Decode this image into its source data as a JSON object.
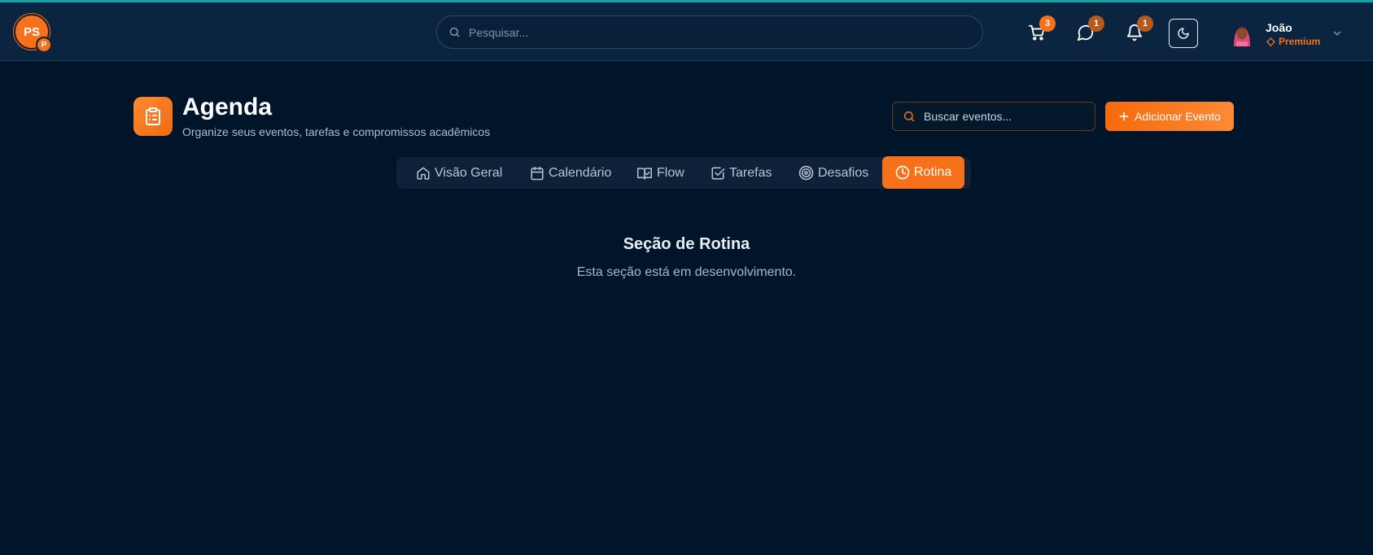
{
  "header": {
    "logo_text": "PS",
    "logo_badge": "P",
    "search_placeholder": "Pesquisar...",
    "cart_count": "3",
    "messages_count": "1",
    "notifications_count": "1",
    "user": {
      "name": "João",
      "plan": "Premium"
    }
  },
  "page": {
    "title": "Agenda",
    "subtitle": "Organize seus eventos, tarefas e compromissos acadêmicos",
    "search_placeholder": "Buscar eventos...",
    "add_button": "Adicionar Evento"
  },
  "tabs": [
    {
      "label": "Visão Geral",
      "icon": "home-icon"
    },
    {
      "label": "Calendário",
      "icon": "calendar-icon"
    },
    {
      "label": "Flow",
      "icon": "book-check-icon"
    },
    {
      "label": "Tarefas",
      "icon": "checkbox-icon"
    },
    {
      "label": "Desafios",
      "icon": "target-icon"
    },
    {
      "label": "Rotina",
      "icon": "clock-icon",
      "active": true
    }
  ],
  "content": {
    "title": "Seção de Rotina",
    "description": "Esta seção está em desenvolvimento."
  },
  "colors": {
    "accent": "#f7711a",
    "background": "#00152a",
    "header": "#0b2440"
  }
}
